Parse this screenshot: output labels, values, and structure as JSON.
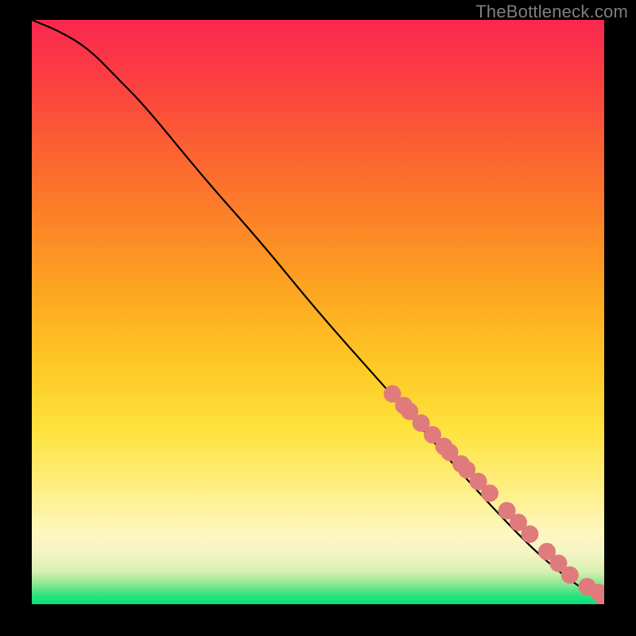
{
  "attribution": "TheBottleneck.com",
  "chart_data": {
    "type": "line",
    "title": "",
    "xlabel": "",
    "ylabel": "",
    "xlim": [
      0,
      100
    ],
    "ylim": [
      0,
      100
    ],
    "x": [
      0,
      5,
      10,
      15,
      20,
      30,
      40,
      50,
      60,
      70,
      80,
      90,
      100
    ],
    "y": [
      100,
      98,
      95,
      90,
      85,
      73,
      62,
      50,
      39,
      28,
      17,
      7,
      0
    ],
    "scatter": {
      "x": [
        63,
        65,
        66,
        68,
        70,
        72,
        73,
        75,
        76,
        78,
        80,
        83,
        85,
        87,
        90,
        92,
        94,
        97,
        99,
        100
      ],
      "y": [
        36,
        34,
        33,
        31,
        29,
        27,
        26,
        24,
        23,
        21,
        19,
        16,
        14,
        12,
        9,
        7,
        5,
        3,
        2,
        1
      ]
    },
    "gradient_stops": [
      {
        "offset": 0.0,
        "color": "#00e47a"
      },
      {
        "offset": 0.015,
        "color": "#2ee27d"
      },
      {
        "offset": 0.035,
        "color": "#8de793"
      },
      {
        "offset": 0.055,
        "color": "#d6f0b0"
      },
      {
        "offset": 0.085,
        "color": "#f2f3c4"
      },
      {
        "offset": 0.12,
        "color": "#fdf7c2"
      },
      {
        "offset": 0.18,
        "color": "#fef191"
      },
      {
        "offset": 0.3,
        "color": "#fee23c"
      },
      {
        "offset": 0.42,
        "color": "#fec524"
      },
      {
        "offset": 0.54,
        "color": "#fda521"
      },
      {
        "offset": 0.66,
        "color": "#fc8228"
      },
      {
        "offset": 0.78,
        "color": "#fb6132"
      },
      {
        "offset": 0.89,
        "color": "#fb4140"
      },
      {
        "offset": 1.0,
        "color": "#fa274f"
      }
    ],
    "scatter_color": "#e07b7d",
    "scatter_radius": 11,
    "line_color": "#000000",
    "line_width": 2.2
  }
}
